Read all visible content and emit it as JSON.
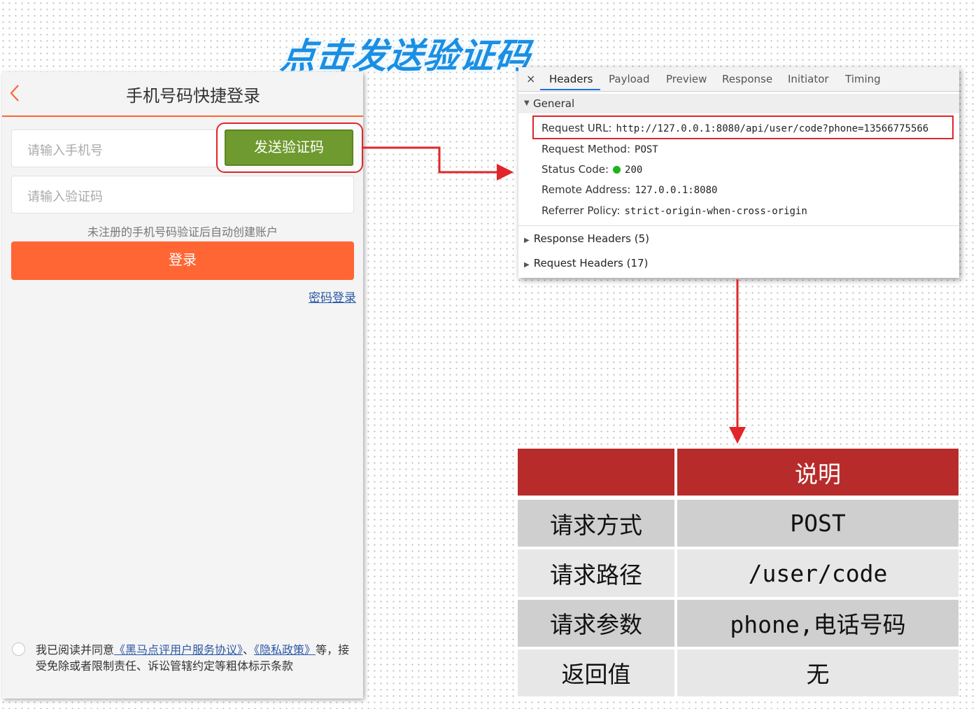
{
  "headline": "点击发送验证码",
  "phone": {
    "title": "手机号码快捷登录",
    "phone_placeholder": "请输入手机号",
    "send_code_label": "发送验证码",
    "code_placeholder": "请输入验证码",
    "hint": "未注册的手机号码验证后自动创建账户",
    "login_label": "登录",
    "password_login": "密码登录",
    "agree_prefix": "我已阅读并同意",
    "agree_link1": "《黑马点评用户服务协议》",
    "agree_sep": "、",
    "agree_link2": "《隐私政策》",
    "agree_suffix": "等，接受免除或者限制责任、诉讼管辖约定等粗体标示条款"
  },
  "devtools": {
    "close": "×",
    "tabs": [
      "Headers",
      "Payload",
      "Preview",
      "Response",
      "Initiator",
      "Timing"
    ],
    "general_label": "General",
    "request_url_key": "Request URL:",
    "request_url": "http://127.0.0.1:8080/api/user/code?phone=13566775566",
    "request_method_key": "Request Method:",
    "request_method": "POST",
    "status_code_key": "Status Code:",
    "status_code": "200",
    "remote_address_key": "Remote Address:",
    "remote_address": "127.0.0.1:8080",
    "referrer_policy_key": "Referrer Policy:",
    "referrer_policy": "strict-origin-when-cross-origin",
    "response_headers": "Response Headers (5)",
    "request_headers": "Request Headers (17)"
  },
  "table": {
    "header": [
      "",
      "说明"
    ],
    "rows": [
      [
        "请求方式",
        "POST"
      ],
      [
        "请求路径",
        "/user/code"
      ],
      [
        "请求参数",
        "phone,电话号码"
      ],
      [
        "返回值",
        "无"
      ]
    ]
  },
  "colors": {
    "accent_orange": "#ff6633",
    "send_green": "#6f9a2f",
    "highlight_red": "#e0262a",
    "table_header": "#b82b2b",
    "headline_blue": "#1a8fe3"
  }
}
